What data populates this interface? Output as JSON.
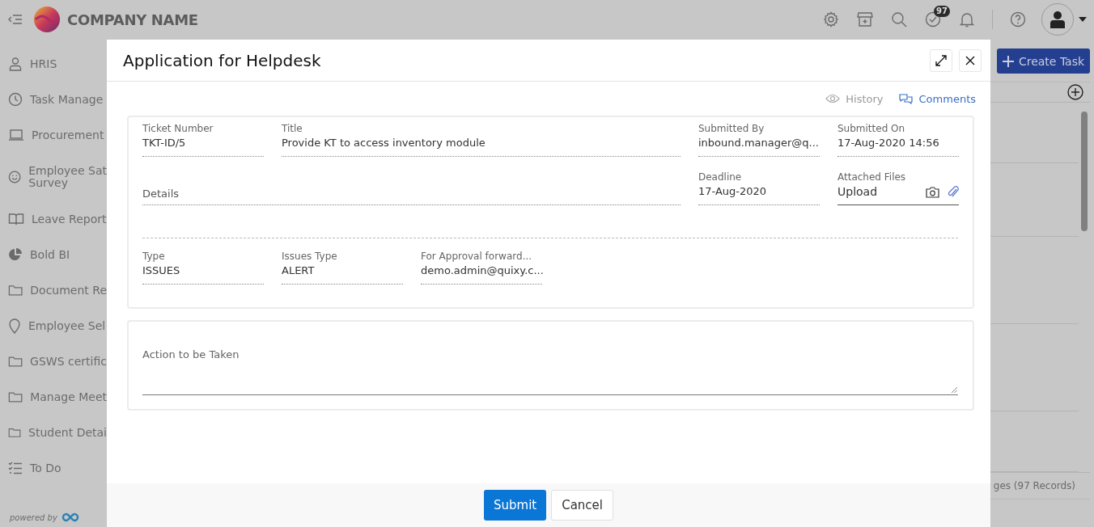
{
  "header": {
    "company_name": "COMPANY NAME",
    "task_count": "97"
  },
  "sidebar": {
    "items": [
      {
        "label": "HRIS",
        "kind": "person"
      },
      {
        "label": "Task Manage",
        "kind": "clock"
      },
      {
        "label": "Procurement",
        "kind": "laptop"
      },
      {
        "label": "Employee Sat\nSurvey",
        "kind": "smiley"
      },
      {
        "label": "Leave Report",
        "kind": "book"
      },
      {
        "label": "Bold BI",
        "kind": "pie"
      },
      {
        "label": "Document Re",
        "kind": "folder"
      },
      {
        "label": "Employee Sel",
        "kind": "pin"
      },
      {
        "label": "GSWS certific",
        "kind": "folder"
      },
      {
        "label": "Manage Meet",
        "kind": "folder"
      },
      {
        "label": "Student Detai",
        "kind": "folder"
      },
      {
        "label": "To Do",
        "kind": "checklist"
      }
    ],
    "footer": "powered by"
  },
  "background": {
    "create_button": "Create Task",
    "pager": "ges (97 Records)"
  },
  "dialog": {
    "title": "Application for Helpdesk",
    "links": [
      {
        "label": "History",
        "kind": "history"
      },
      {
        "label": "Comments",
        "kind": "comments"
      }
    ],
    "top_fields": [
      {
        "label": "Ticket Number",
        "value": "TKT-ID/5"
      },
      {
        "label": "Title",
        "value": "Provide KT to access inventory module"
      },
      {
        "label": "Submitted By",
        "value": "inbound.manager@q..."
      },
      {
        "label": "Submitted On",
        "value": "17-Aug-2020 14:56"
      }
    ],
    "details": {
      "label": "Details"
    },
    "deadline": {
      "label": "Deadline",
      "value": "17-Aug-2020"
    },
    "attached_files": {
      "label": "Attached Files",
      "value": "Upload"
    },
    "bottom_fields": [
      {
        "label": "Type",
        "value": "ISSUES"
      },
      {
        "label": "Issues Type",
        "value": "ALERT"
      },
      {
        "label": "For Approval forward...",
        "value": "demo.admin@quixy.c..."
      }
    ],
    "action": {
      "label": "Action to be Taken"
    },
    "buttons": [
      {
        "label": "Submit",
        "kind": "primary"
      },
      {
        "label": "Cancel",
        "kind": "secondary"
      }
    ]
  }
}
